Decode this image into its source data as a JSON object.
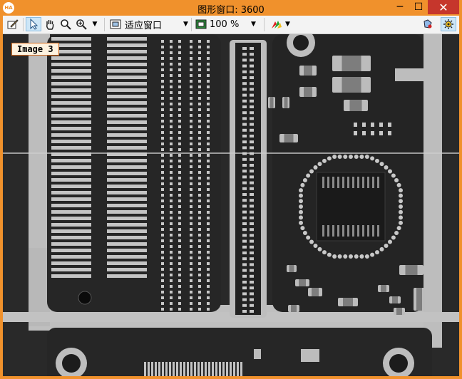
{
  "window": {
    "app_icon_text": "HA",
    "title": "图形窗口: 3600",
    "min_glyph": "─",
    "max_glyph": "☐",
    "close_glyph": "✕"
  },
  "toolbar": {
    "fit_label": "适应窗口",
    "zoom_label": "100 %"
  },
  "canvas": {
    "image_label": "Image 3"
  }
}
